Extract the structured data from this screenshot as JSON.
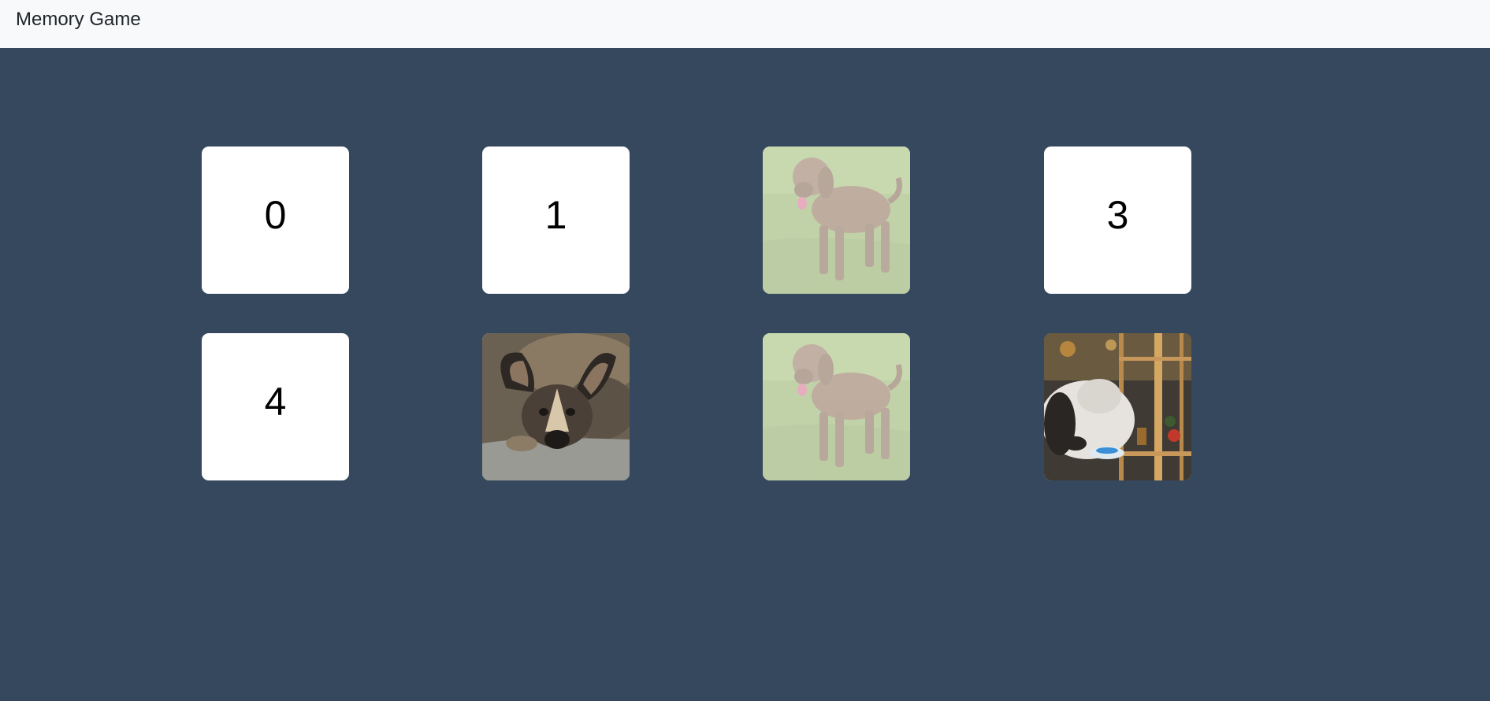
{
  "navbar": {
    "title": "Memory Game"
  },
  "cards": [
    {
      "label": "0",
      "state": "hidden"
    },
    {
      "label": "1",
      "state": "hidden"
    },
    {
      "state": "matched",
      "image": "shaggy-brown-dog-on-grass"
    },
    {
      "label": "3",
      "state": "hidden"
    },
    {
      "label": "4",
      "state": "hidden"
    },
    {
      "state": "revealed",
      "image": "african-wild-dog-resting-on-rock"
    },
    {
      "state": "matched",
      "image": "shaggy-brown-dog-on-grass"
    },
    {
      "state": "revealed",
      "image": "long-haired-dog-eating-from-bowl"
    }
  ],
  "colors": {
    "background": "#35485e",
    "navbar": "#f8f9fa",
    "card": "#ffffff"
  }
}
